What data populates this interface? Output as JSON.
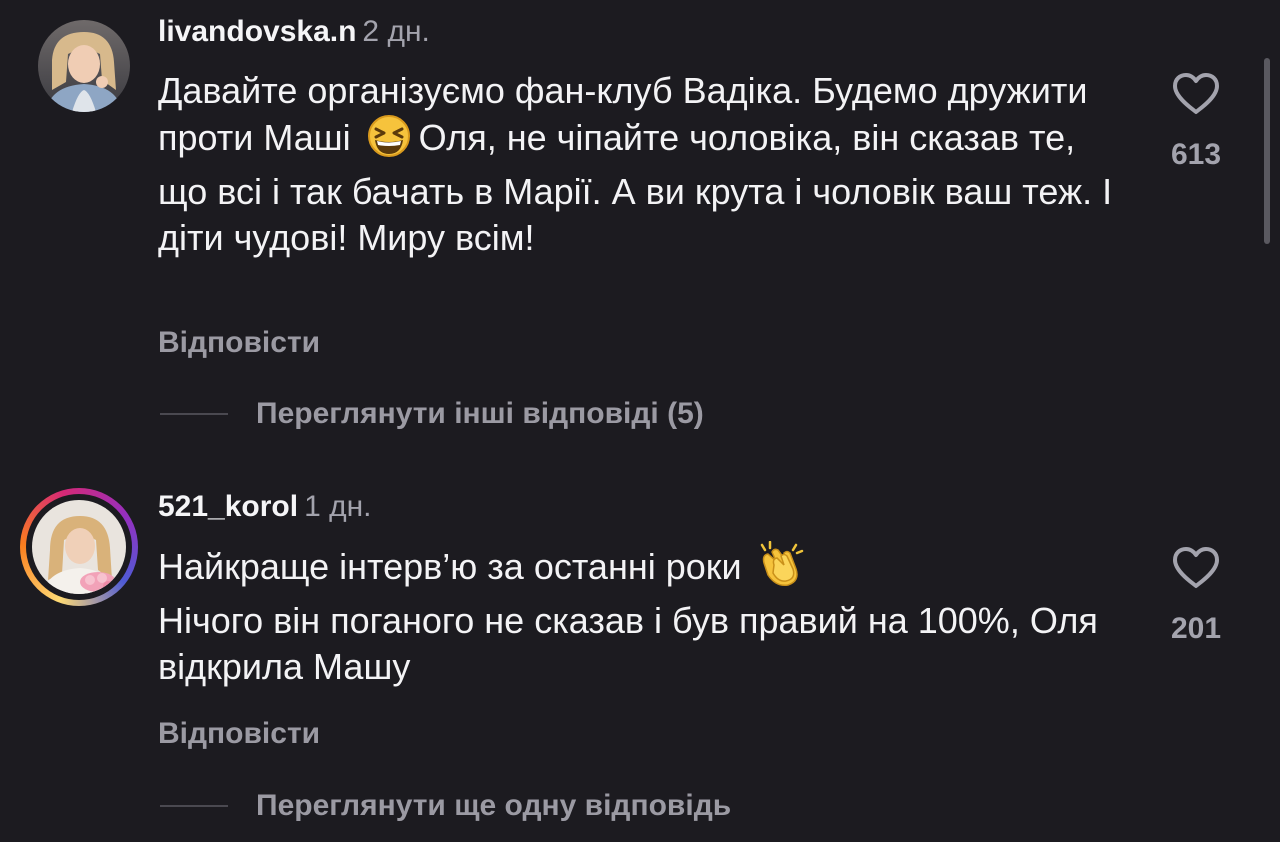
{
  "comments": [
    {
      "username": "livandovska.n",
      "time": "2 дн.",
      "text_before_emoji": "Давайте організуємо фан-клуб Вадіка. Будемо дружити проти Маші",
      "emoji": "grinning-squinting-face",
      "text_after_emoji": "Оля, не чіпайте чоловіка, він сказав те, що всі і так бачать в Марії. А ви крута і чоловік ваш теж. І діти чудові! Миру всім!",
      "likes": "613",
      "reply_label": "Відповісти",
      "view_replies_label": "Переглянути інші відповіді (5)",
      "has_story_ring": false
    },
    {
      "username": "521_korol",
      "time": "1 дн.",
      "line1": "Найкраще інтерв’ю за останні роки",
      "emoji": "clapping-hands",
      "text_after_emoji": "Нічого він поганого не сказав і був правий на 100%, Оля відкрила Машу",
      "likes": "201",
      "reply_label": "Відповісти",
      "view_replies_label": "Переглянути ще одну відповідь",
      "has_story_ring": true
    }
  ],
  "colors": {
    "background": "#1c1b20",
    "primary_text": "#f3f3f5",
    "secondary_text": "#9b9aa3",
    "story_ring": [
      "#feda75",
      "#fa7e1e",
      "#d62976",
      "#962fbf",
      "#4f5bd5"
    ]
  }
}
